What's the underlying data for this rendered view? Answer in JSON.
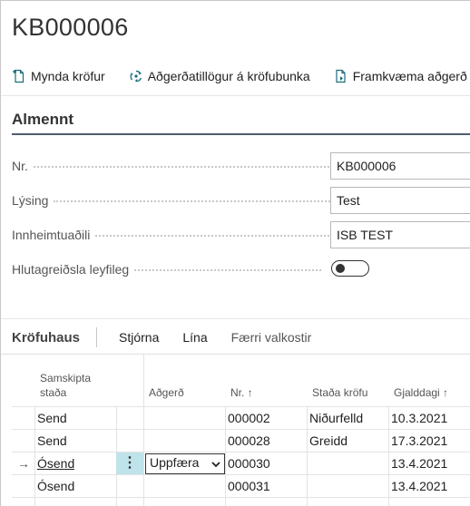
{
  "page": {
    "title": "KB000006"
  },
  "actions": [
    {
      "label": "Mynda kröfur",
      "icon": "create-document-icon"
    },
    {
      "label": "Aðgerðatillögur á kröfubunka",
      "icon": "recycle-suggest-icon"
    },
    {
      "label": "Framkvæma aðgerð",
      "icon": "execute-document-icon"
    }
  ],
  "general": {
    "title": "Almennt",
    "fields": [
      {
        "label": "Nr.",
        "value": "KB000006"
      },
      {
        "label": "Lýsing",
        "value": "Test"
      },
      {
        "label": "Innheimtuaðili",
        "value": "ISB TEST"
      }
    ],
    "toggle": {
      "label": "Hlutagreiðsla leyfileg",
      "value": false
    }
  },
  "part": {
    "title": "Kröfuhaus",
    "actions": [
      "Stjórna",
      "Lína",
      "Færri valkostir"
    ],
    "columns": {
      "status": [
        "Samskipta",
        "staða"
      ],
      "action": "Aðgerð",
      "no": "Nr.",
      "claim_status": "Staða kröfu",
      "due": "Gjalddagi"
    },
    "rows": [
      {
        "status": "Send",
        "action": "",
        "no": "000002",
        "claim_status": "Niðurfelld",
        "due": "10.3.2021"
      },
      {
        "status": "Send",
        "action": "",
        "no": "000028",
        "claim_status": "Greidd",
        "due": "17.3.2021"
      },
      {
        "status": "Ósend",
        "action": "Uppfæra",
        "no": "000030",
        "claim_status": "",
        "due": "13.4.2021"
      },
      {
        "status": "Ósend",
        "action": "",
        "no": "000031",
        "claim_status": "",
        "due": "13.4.2021"
      }
    ]
  }
}
